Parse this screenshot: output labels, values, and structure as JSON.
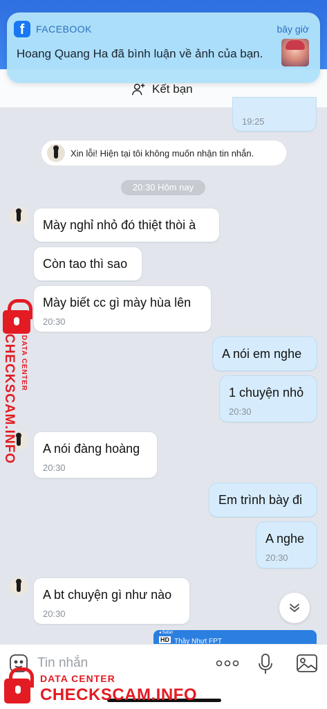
{
  "notification": {
    "app": "FACEBOOK",
    "time": "bây giờ",
    "message": "Hoang Quang Ha đã bình luận về ảnh của bạn."
  },
  "header": {
    "add_friend_label": "Kết bạn"
  },
  "prev_message": {
    "time": "19:25"
  },
  "system_message": "Xin lỗi! Hiện tại tôi không muốn nhận tin nhắn.",
  "date_separator": "20:30 Hôm nay",
  "messages": [
    {
      "dir": "in",
      "text": "Mày nghỉ nhỏ đó thiệt thòi à"
    },
    {
      "dir": "in",
      "text": "Còn tao thì sao"
    },
    {
      "dir": "in",
      "text": "Mày biết cc gì mày hùa lên",
      "time": "20:30"
    },
    {
      "dir": "out",
      "text": "A nói em nghe"
    },
    {
      "dir": "out",
      "text": "1 chuyện nhỏ",
      "time": "20:30"
    },
    {
      "dir": "in",
      "text": "A nói đàng hoàng",
      "time": "20:30"
    },
    {
      "dir": "out",
      "text": "Em trình bày đi"
    },
    {
      "dir": "out",
      "text": "A nghe",
      "time": "20:30"
    },
    {
      "dir": "in",
      "text": "A bt chuyện gì như nào",
      "time": "20:30"
    }
  ],
  "peek_bar": {
    "badge": "HD",
    "title": "Thầy Nhựt FPT",
    "source": "◂ Safari"
  },
  "composer": {
    "placeholder": "Tin nhắn"
  },
  "watermark": {
    "subtitle": "DATA CENTER",
    "title": "CHECKSCAM.INFO"
  },
  "colors": {
    "outgoing": "#d6ecfc",
    "incoming": "#ffffff",
    "accent": "#2f6fe0",
    "watermark": "#e31b23"
  }
}
